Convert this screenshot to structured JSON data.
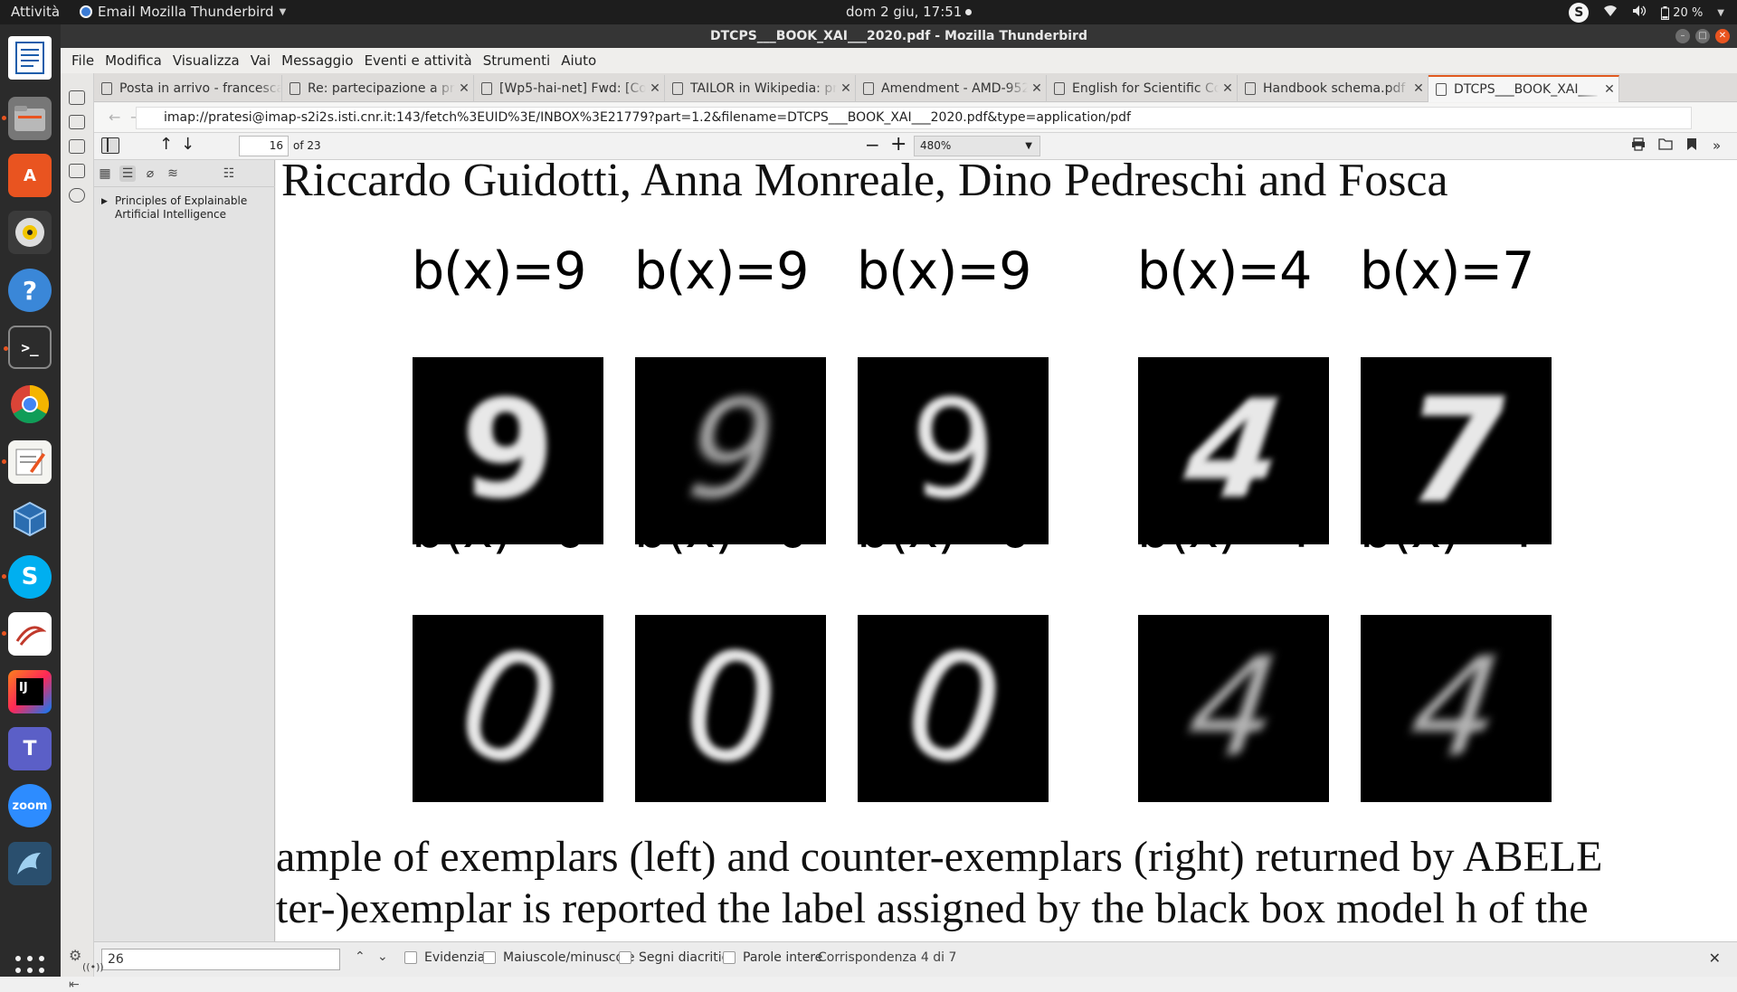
{
  "topbar": {
    "activities": "Attività",
    "app_name": "Email Mozilla Thunderbird",
    "clock": "dom  2 giu, 17:51",
    "battery": "20 %"
  },
  "window": {
    "title": "DTCPS___BOOK_XAI___2020.pdf - Mozilla Thunderbird"
  },
  "menu": [
    "File",
    "Modifica",
    "Visualizza",
    "Vai",
    "Messaggio",
    "Eventi e attività",
    "Strumenti",
    "Aiuto"
  ],
  "tabs": [
    {
      "label": "Posta in arrivo - francesca"
    },
    {
      "label": "Re: partecipazione a proge"
    },
    {
      "label": "[Wp5-hai-net] Fwd: [Comi"
    },
    {
      "label": "TAILOR in Wikipedia: pro"
    },
    {
      "label": "Amendment - AMD-952"
    },
    {
      "label": "English for Scientific Com"
    },
    {
      "label": "Handbook schema.pdf"
    },
    {
      "label": "DTCPS___BOOK_XAI___"
    }
  ],
  "url": "imap://pratesi@imap-s2i2s.isti.cnr.it:143/fetch%3EUID%3E/INBOX%3E21779?part=1.2&filename=DTCPS___BOOK_XAI___2020.pdf&type=application/pdf",
  "pdf_toolbar": {
    "page_number": "16",
    "page_total": "of 23",
    "zoom": "480%"
  },
  "sidebar": {
    "outline_item": "Principles of Explainable Artificial Intelligence"
  },
  "pdf": {
    "authors": "Riccardo Guidotti, Anna Monreale, Dino Pedreschi and Fosca",
    "labels_row1": [
      "b(x)=9",
      "b(x)=9",
      "b(x)=9",
      "b(x)=4",
      "b(x)=7"
    ],
    "labels_row2": [
      "b(x)=0",
      "b(x)=0",
      "b(x)=0",
      "b(x)=4",
      "b(x)=4"
    ],
    "digits_row1": [
      "9",
      "9",
      "9",
      "4",
      "7"
    ],
    "digits_row2": [
      "0",
      "0",
      "0",
      "4",
      "4"
    ],
    "caption_line1": "ample of exemplars (left) and counter-exemplars (right) returned by ABELE",
    "caption_line2": "ter-)exemplar is reported the label assigned by the black box model h of the"
  },
  "findbar": {
    "query": "26",
    "highlight": "Evidenzia",
    "match_case": "Maiuscole/minuscole",
    "diacritics": "Segni diacritici",
    "whole_words": "Parole intere",
    "result": "Corrispondenza 4 di 7"
  },
  "colors": {
    "accent": "#e95420",
    "topbar_bg": "#1d1d1d",
    "dock_bg": "#2b2b2b"
  }
}
